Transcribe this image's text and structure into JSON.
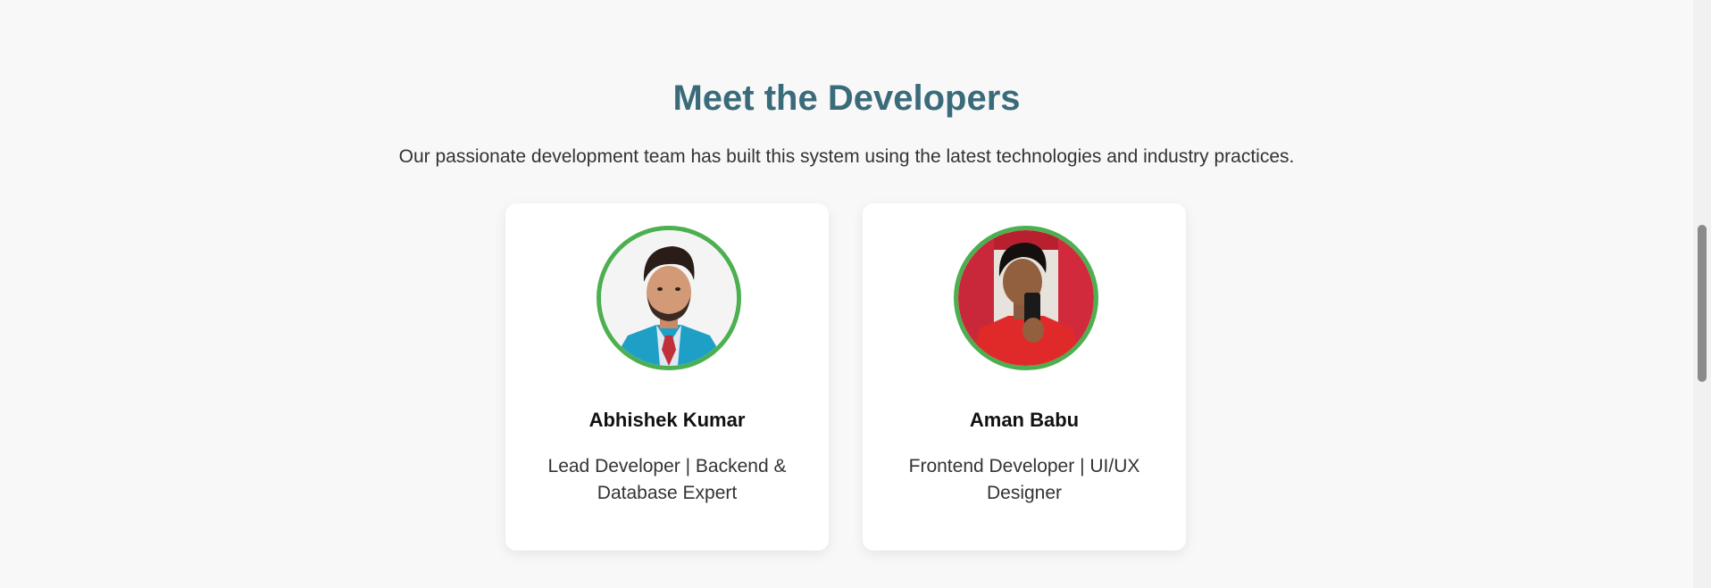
{
  "section": {
    "title": "Meet the Developers",
    "subtitle": "Our passionate development team has built this system using the latest technologies and industry practices."
  },
  "developers": [
    {
      "name": "Abhishek Kumar",
      "role": "Lead Developer | Backend & Database Expert",
      "photo": "developer-portrait-photo"
    },
    {
      "name": "Aman Babu",
      "role": "Frontend Developer | UI/UX Designer",
      "photo": "developer-selfie-photo"
    }
  ],
  "colors": {
    "title": "#3a6b7a",
    "avatar_border": "#4caf50",
    "background": "#f8f8f8",
    "card": "#ffffff"
  }
}
